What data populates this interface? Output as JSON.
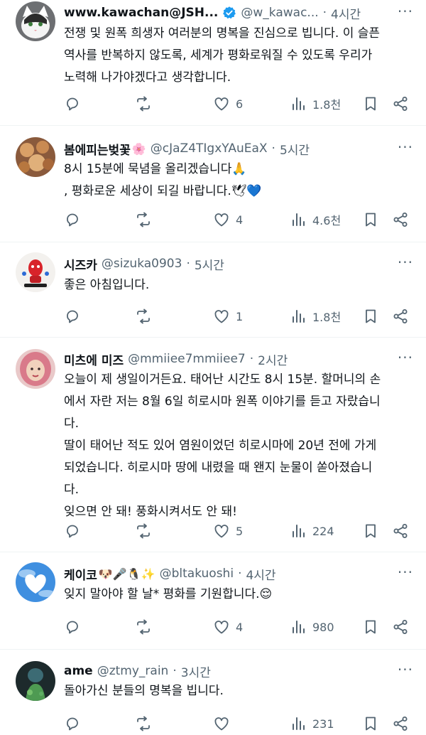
{
  "tweets": [
    {
      "name": "www.kawachan@JSH...",
      "verified": true,
      "handle": "@w_kawac...",
      "time": "4시간",
      "lines": [
        "전쟁 및 원폭 희생자 여러분의 명복을 진심으로 빕니다. 이 슬픈",
        "역사를 반복하지 않도록, 세계가 평화로워질 수 있도록 우리가",
        "노력해 나가야겠다고 생각합니다."
      ],
      "likes": "6",
      "views": "1.8천",
      "avatar": "cat-avatar"
    },
    {
      "name": "봄에피는벚꽃",
      "name_emoji": "🌸",
      "handle": "@cJaZ4TIgxYAuEaX",
      "time": "5시간",
      "lines": [
        " 8시 15분에 묵념을 올리겠습니다🙏",
        ", 평화로운 세상이 되길 바랍니다.🕊💙"
      ],
      "likes": "4",
      "views": "4.6천",
      "avatar": "mushroom-avatar"
    },
    {
      "name": "시즈카",
      "handle": "@sizuka0903",
      "time": "5시간",
      "lines": [
        "좋은 아침입니다."
      ],
      "likes": "1",
      "views": "1.8천",
      "avatar": "red-character-avatar"
    },
    {
      "name": "미츠에 미즈",
      "handle": "@mmiiee7mmiiee7",
      "time": "2시간",
      "lines": [
        "오늘이 제 생일이거든요. 태어난 시간도 8시 15분. 할머니의 손",
        "에서 자란 저는 8월 6일 히로시마 원폭 이야기를 듣고 자랐습니",
        "다.",
        "딸이 태어난 적도 있어 염원이었던 히로시마에 20년 전에 가게",
        "되었습니다. 히로시마 땅에 내렸을 때 왠지 눈물이 쏟아졌습니",
        "다.",
        "잊으면 안 돼! 풍화시켜서도 안 돼!"
      ],
      "likes": "5",
      "views": "224",
      "avatar": "woman-avatar"
    },
    {
      "name": "케이코",
      "name_emoji": "🐶🎤🐧✨",
      "handle": "@bltakuoshi",
      "time": "4시간",
      "lines": [
        "잊지 말아야 할 날* 평화를 기원합니다.😌"
      ],
      "likes": "4",
      "views": "980",
      "avatar": "cloud-heart-avatar"
    },
    {
      "name": "ame",
      "handle": "@ztmy_rain",
      "time": "3시간",
      "lines": [
        "돌아가신 분들의 명복을 빕니다."
      ],
      "likes": "",
      "views": "231",
      "avatar": "green-figure-avatar"
    }
  ],
  "separator": "·",
  "colors": {
    "text": "#0f1419",
    "secondary": "#536471",
    "verified": "#1d9bf0",
    "divider": "#eff3f4"
  }
}
